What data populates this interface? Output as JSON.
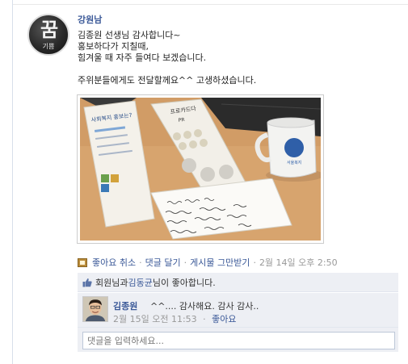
{
  "post": {
    "author": "강원남",
    "avatar_text": "꿈",
    "avatar_sub": "기쁨",
    "message_lines": [
      "김종원 선생님 감사합니다~",
      "홍보하다가 지칠때,",
      "힘겨울 때 자주 들여다 보겠습니다."
    ],
    "message_line2": "주위분들에게도 전달할께요^^ 고생하셨습니다.",
    "photo": {
      "brochure_title": "사회복지 홍보는?",
      "card_title": "프로카드다",
      "card_sub": "PR",
      "mug_brand": "서울복지"
    }
  },
  "actions": {
    "unlike": "좋아요 취소",
    "comment": "댓글 달기",
    "unfollow": "게시물 그만받기",
    "timestamp": "2월 14일 오후 2:50",
    "separator": "·"
  },
  "likes": {
    "prefix": "회원님과 ",
    "liker": "김동균",
    "suffix": "님이 좋아합니다."
  },
  "comment": {
    "author": "김종원",
    "text": "^^.... 감사해요. 감사 감사..",
    "timestamp": "2월 15일 오전 11:53",
    "like": "좋아요"
  },
  "composer": {
    "placeholder": "댓글을 입력하세요..."
  }
}
